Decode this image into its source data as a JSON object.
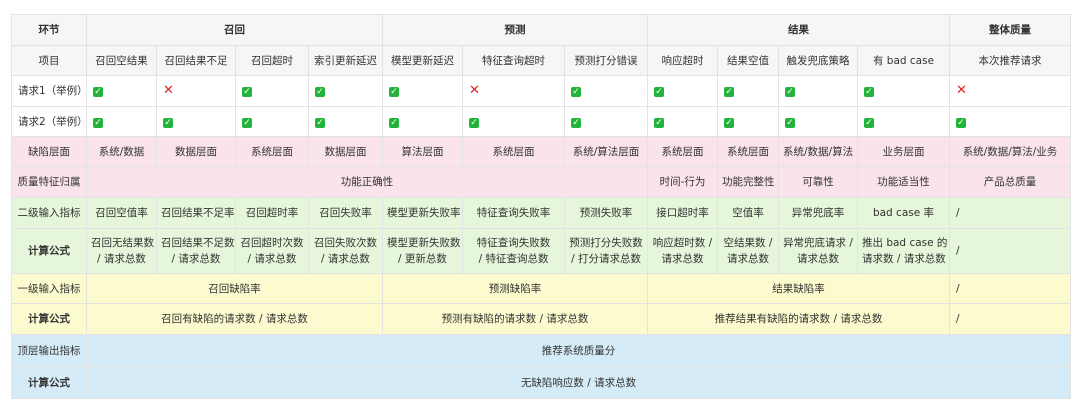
{
  "colors": {
    "check": "#22b33a",
    "cross": "#e21f1f",
    "pink": "#fae3ec",
    "green": "#e5f6da",
    "yellow": "#fcfbcf",
    "blue": "#d5ecf8"
  },
  "rows": [
    {
      "bg": "header",
      "label": "环节",
      "label_bold": true,
      "cells": [
        {
          "text": "召回",
          "span": 4,
          "bold": true
        },
        {
          "text": "预测",
          "span": 3,
          "bold": true
        },
        {
          "text": "结果",
          "span": 4,
          "bold": true
        },
        {
          "text": "整体质量",
          "span": 1,
          "bold": true
        }
      ]
    },
    {
      "bg": "header",
      "label": "项目",
      "cells": [
        {
          "text": "召回空结果"
        },
        {
          "text": "召回结果不足"
        },
        {
          "text": "召回超时"
        },
        {
          "text": "索引更新延迟"
        },
        {
          "text": "模型更新延迟"
        },
        {
          "text": "特征查询超时"
        },
        {
          "text": "预测打分错误"
        },
        {
          "text": "响应超时"
        },
        {
          "text": "结果空值"
        },
        {
          "text": "触发兜底策略"
        },
        {
          "text": "有 bad case"
        },
        {
          "text": "本次推荐请求"
        }
      ]
    },
    {
      "bg": "white",
      "label": "请求1（举例）",
      "label_left": true,
      "cells": [
        {
          "icon": "check"
        },
        {
          "icon": "cross"
        },
        {
          "icon": "check"
        },
        {
          "icon": "check"
        },
        {
          "icon": "check"
        },
        {
          "icon": "cross"
        },
        {
          "icon": "check"
        },
        {
          "icon": "check"
        },
        {
          "icon": "check"
        },
        {
          "icon": "check"
        },
        {
          "icon": "check"
        },
        {
          "icon": "cross"
        }
      ]
    },
    {
      "bg": "white",
      "label": "请求2（举例）",
      "label_left": true,
      "cells": [
        {
          "icon": "check"
        },
        {
          "icon": "check"
        },
        {
          "icon": "check"
        },
        {
          "icon": "check"
        },
        {
          "icon": "check"
        },
        {
          "icon": "check"
        },
        {
          "icon": "check"
        },
        {
          "icon": "check"
        },
        {
          "icon": "check"
        },
        {
          "icon": "check"
        },
        {
          "icon": "check"
        },
        {
          "icon": "check"
        }
      ]
    },
    {
      "bg": "pink",
      "label": "缺陷层面",
      "cells": [
        {
          "text": "系统/数据"
        },
        {
          "text": "数据层面"
        },
        {
          "text": "系统层面"
        },
        {
          "text": "数据层面"
        },
        {
          "text": "算法层面"
        },
        {
          "text": "系统层面"
        },
        {
          "text": "系统/算法层面"
        },
        {
          "text": "系统层面"
        },
        {
          "text": "系统层面"
        },
        {
          "text": "系统/数据/算法"
        },
        {
          "text": "业务层面"
        },
        {
          "text": "系统/数据/算法/业务"
        }
      ]
    },
    {
      "bg": "pink",
      "label": "质量特征归属",
      "cells": [
        {
          "text": "功能正确性",
          "span": 7
        },
        {
          "text": "时间-行为"
        },
        {
          "text": "功能完整性"
        },
        {
          "text": "可靠性"
        },
        {
          "text": "功能适当性"
        },
        {
          "text": "产品总质量"
        }
      ]
    },
    {
      "bg": "green",
      "label": "二级输入指标",
      "cells": [
        {
          "text": "召回空值率"
        },
        {
          "text": "召回结果不足率"
        },
        {
          "text": "召回超时率"
        },
        {
          "text": "召回失败率"
        },
        {
          "text": "模型更新失败率"
        },
        {
          "text": "特征查询失败率"
        },
        {
          "text": "预测失败率"
        },
        {
          "text": "接口超时率"
        },
        {
          "text": "空值率"
        },
        {
          "text": "异常兜底率"
        },
        {
          "text": "bad case 率"
        },
        {
          "text": "/",
          "left": true
        }
      ]
    },
    {
      "bg": "green",
      "label": "计算公式",
      "label_bold": true,
      "tall": true,
      "cells": [
        {
          "text": "召回无结果数",
          "text2": "/ 请求总数"
        },
        {
          "text": "召回结果不足数",
          "text2": "/ 请求总数"
        },
        {
          "text": "召回超时次数",
          "text2": "/ 请求总数"
        },
        {
          "text": "召回失败次数",
          "text2": "/ 请求总数"
        },
        {
          "text": "模型更新失败数",
          "text2": "/ 更新总数"
        },
        {
          "text": "特征查询失败数",
          "text2": "/ 特征查询总数"
        },
        {
          "text": "预测打分失败数",
          "text2": "/ 打分请求总数"
        },
        {
          "text": "响应超时数 /",
          "text2": "请求总数"
        },
        {
          "text": "空结果数 /",
          "text2": "请求总数"
        },
        {
          "text": "异常兜底请求 /",
          "text2": "请求总数"
        },
        {
          "text": "推出 bad case 的",
          "text2": "请求数 / 请求总数"
        },
        {
          "text": "/",
          "left": true
        }
      ]
    },
    {
      "bg": "yellow",
      "label": "一级输入指标",
      "cells": [
        {
          "text": "召回缺陷率",
          "span": 4
        },
        {
          "text": "预测缺陷率",
          "span": 3
        },
        {
          "text": "结果缺陷率",
          "span": 4
        },
        {
          "text": "/",
          "left": true
        }
      ]
    },
    {
      "bg": "yellow",
      "label": "计算公式",
      "label_bold": true,
      "cells": [
        {
          "text": "召回有缺陷的请求数 / 请求总数",
          "span": 4
        },
        {
          "text": "预测有缺陷的请求数 / 请求总数",
          "span": 3
        },
        {
          "text": "推荐结果有缺陷的请求数 / 请求总数",
          "span": 4
        },
        {
          "text": "/",
          "left": true
        }
      ]
    },
    {
      "bg": "blue",
      "label": "顶层输出指标",
      "cells": [
        {
          "text": "推荐系统质量分",
          "span": 12
        }
      ]
    },
    {
      "bg": "blue",
      "label": "计算公式",
      "label_bold": true,
      "cells": [
        {
          "text": "无缺陷响应数 / 请求总数",
          "span": 12
        }
      ]
    }
  ]
}
